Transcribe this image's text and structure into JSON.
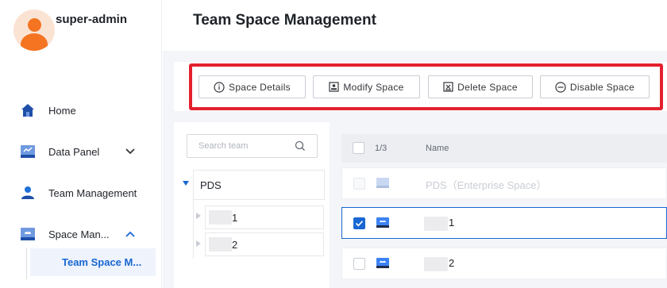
{
  "sidebar": {
    "username": "super-admin",
    "items": [
      {
        "label": "Home",
        "icon": "home-icon"
      },
      {
        "label": "Data Panel",
        "icon": "data-panel-icon",
        "expanded": false
      },
      {
        "label": "Team Management",
        "icon": "team-icon"
      },
      {
        "label": "Space Man...",
        "icon": "space-icon",
        "expanded": true
      }
    ],
    "sub_items": [
      {
        "label": "Team Space M..."
      }
    ]
  },
  "header": {
    "title": "Team Space Management"
  },
  "toolbar": {
    "space_details": "Space Details",
    "modify_space": "Modify Space",
    "delete_space": "Delete Space",
    "disable_space": "Disable Space"
  },
  "tree": {
    "search_placeholder": "Search team",
    "root": "PDS",
    "children": [
      {
        "label": "1"
      },
      {
        "label": "2"
      }
    ]
  },
  "table": {
    "selection_count": "1/3",
    "name_header": "Name",
    "rows": [
      {
        "name": "PDS（Enterprise Space）",
        "disabled": true,
        "checked": false
      },
      {
        "name": "1",
        "disabled": false,
        "checked": true
      },
      {
        "name": "2",
        "disabled": false,
        "checked": false
      }
    ]
  },
  "colors": {
    "accent": "#1967d2",
    "highlight": "#e3202e",
    "avatar": "#f47421"
  }
}
